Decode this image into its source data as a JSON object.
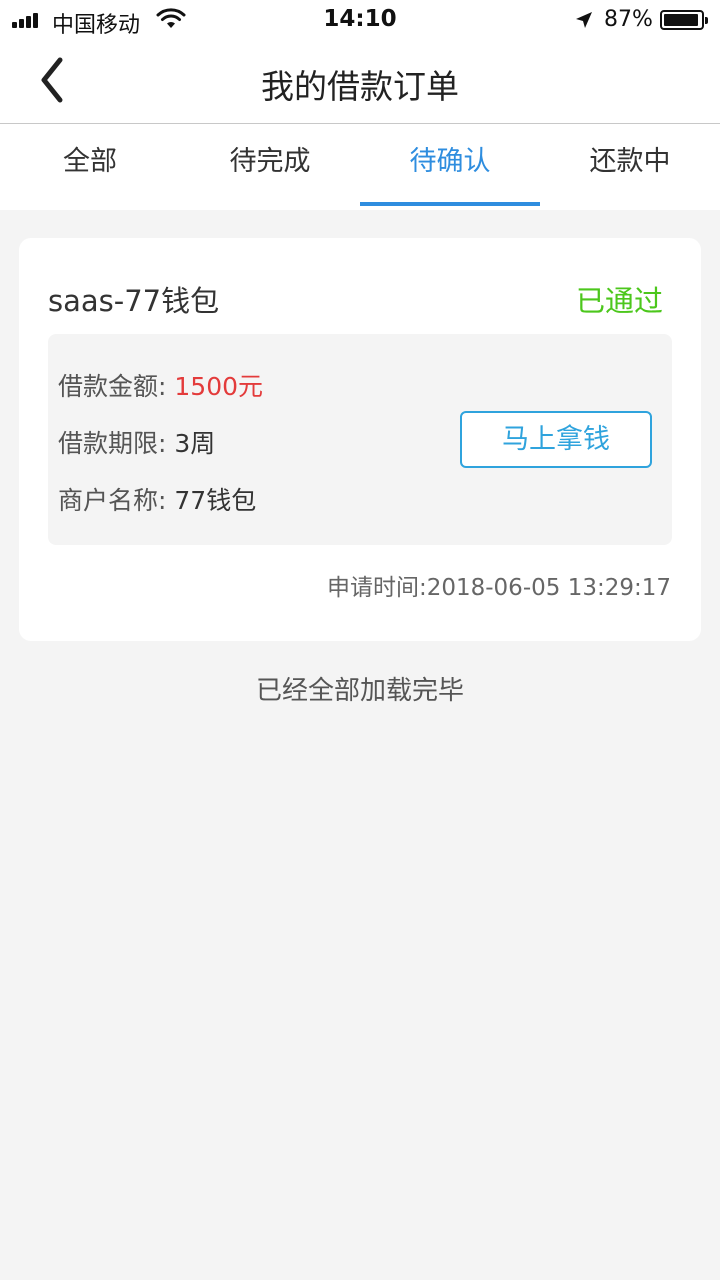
{
  "status_bar": {
    "carrier": "中国移动",
    "time": "14:10",
    "battery": "87%"
  },
  "nav": {
    "title": "我的借款订单",
    "back_icon": "chevron-left-icon"
  },
  "tabs": [
    {
      "label": "全部",
      "active": false
    },
    {
      "label": "待完成",
      "active": false
    },
    {
      "label": "待确认",
      "active": true
    },
    {
      "label": "还款中",
      "active": false
    }
  ],
  "order": {
    "title": "saas-77钱包",
    "status": "已通过",
    "amount_label": "借款金额:",
    "amount_value": "1500元",
    "term_label": "借款期限:",
    "term_value": "3周",
    "merchant_label": "商户名称:",
    "merchant_value": "77钱包",
    "action_label": "马上拿钱",
    "apply_time": "申请时间:2018-06-05 13:29:17"
  },
  "footer": {
    "end_text": "已经全部加载完毕"
  },
  "colors": {
    "accent": "#2e8ddf",
    "status_green": "#4cc71c",
    "amount_red": "#e33b3b",
    "button_blue": "#2fa3dd",
    "background": "#f4f4f4"
  }
}
